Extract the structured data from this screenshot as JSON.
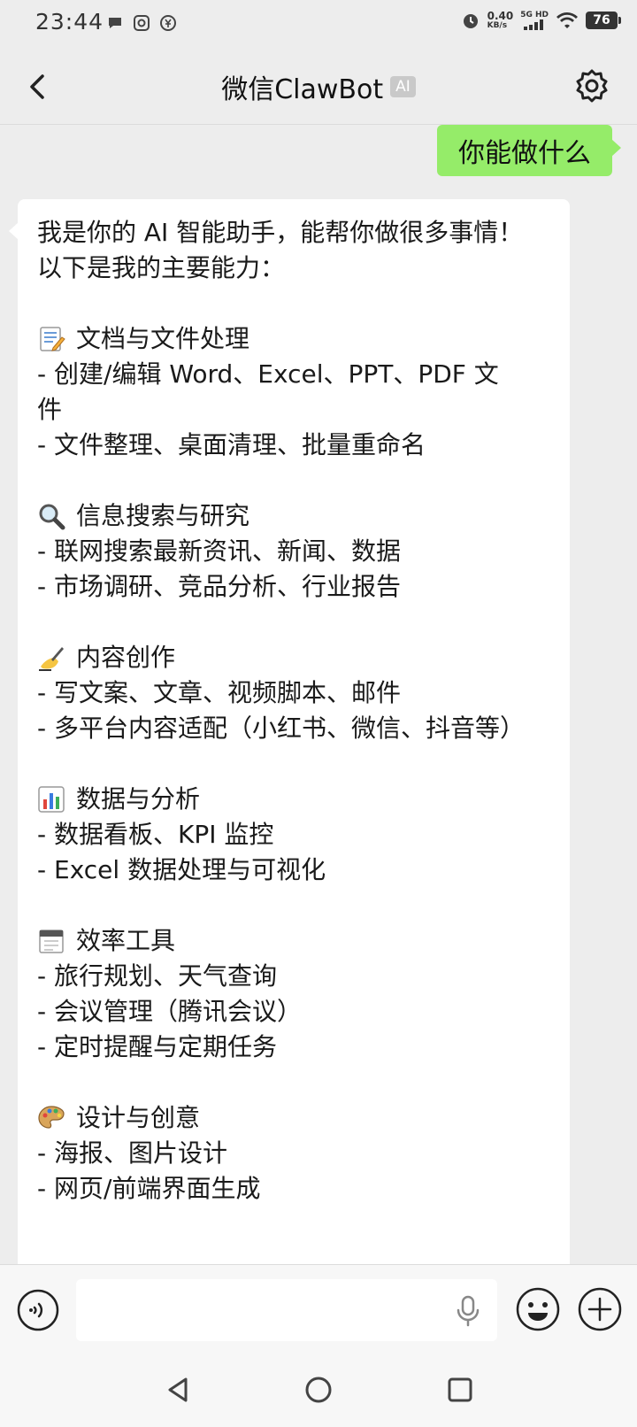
{
  "status_bar": {
    "time": "23:44",
    "net_speed": "0.40",
    "net_unit": "KB/s",
    "network": "5G HD",
    "battery": "76"
  },
  "header": {
    "title": "微信ClawBot",
    "badge": "AI"
  },
  "messages": {
    "user": "你能做什么",
    "bot": {
      "intro": [
        "我是你的 AI 智能助手，能帮你做很多事情！",
        "以下是我的主要能力："
      ],
      "sections": [
        {
          "icon": "memo-icon",
          "title": "文档与文件处理",
          "lines": [
            "- 创建/编辑 Word、Excel、PPT、PDF 文",
            "件",
            "- 文件整理、桌面清理、批量重命名"
          ]
        },
        {
          "icon": "magnifier-icon",
          "title": "信息搜索与研究",
          "lines": [
            "- 联网搜索最新资讯、新闻、数据",
            "- 市场调研、竞品分析、行业报告"
          ]
        },
        {
          "icon": "writing-hand-icon",
          "title": "内容创作",
          "lines": [
            "- 写文案、文章、视频脚本、邮件",
            "- 多平台内容适配（小红书、微信、抖音等）"
          ]
        },
        {
          "icon": "bar-chart-icon",
          "title": "数据与分析",
          "lines": [
            "- 数据看板、KPI 监控",
            "- Excel 数据处理与可视化"
          ]
        },
        {
          "icon": "calendar-icon",
          "title": "效率工具",
          "lines": [
            "- 旅行规划、天气查询",
            "- 会议管理（腾讯会议）",
            "- 定时提醒与定期任务"
          ]
        },
        {
          "icon": "palette-icon",
          "title": "设计与创意",
          "lines": [
            "- 海报、图片设计",
            "- 网页/前端界面生成"
          ]
        }
      ]
    }
  },
  "colors": {
    "user_bubble": "#95ec69",
    "background": "#ededed"
  }
}
